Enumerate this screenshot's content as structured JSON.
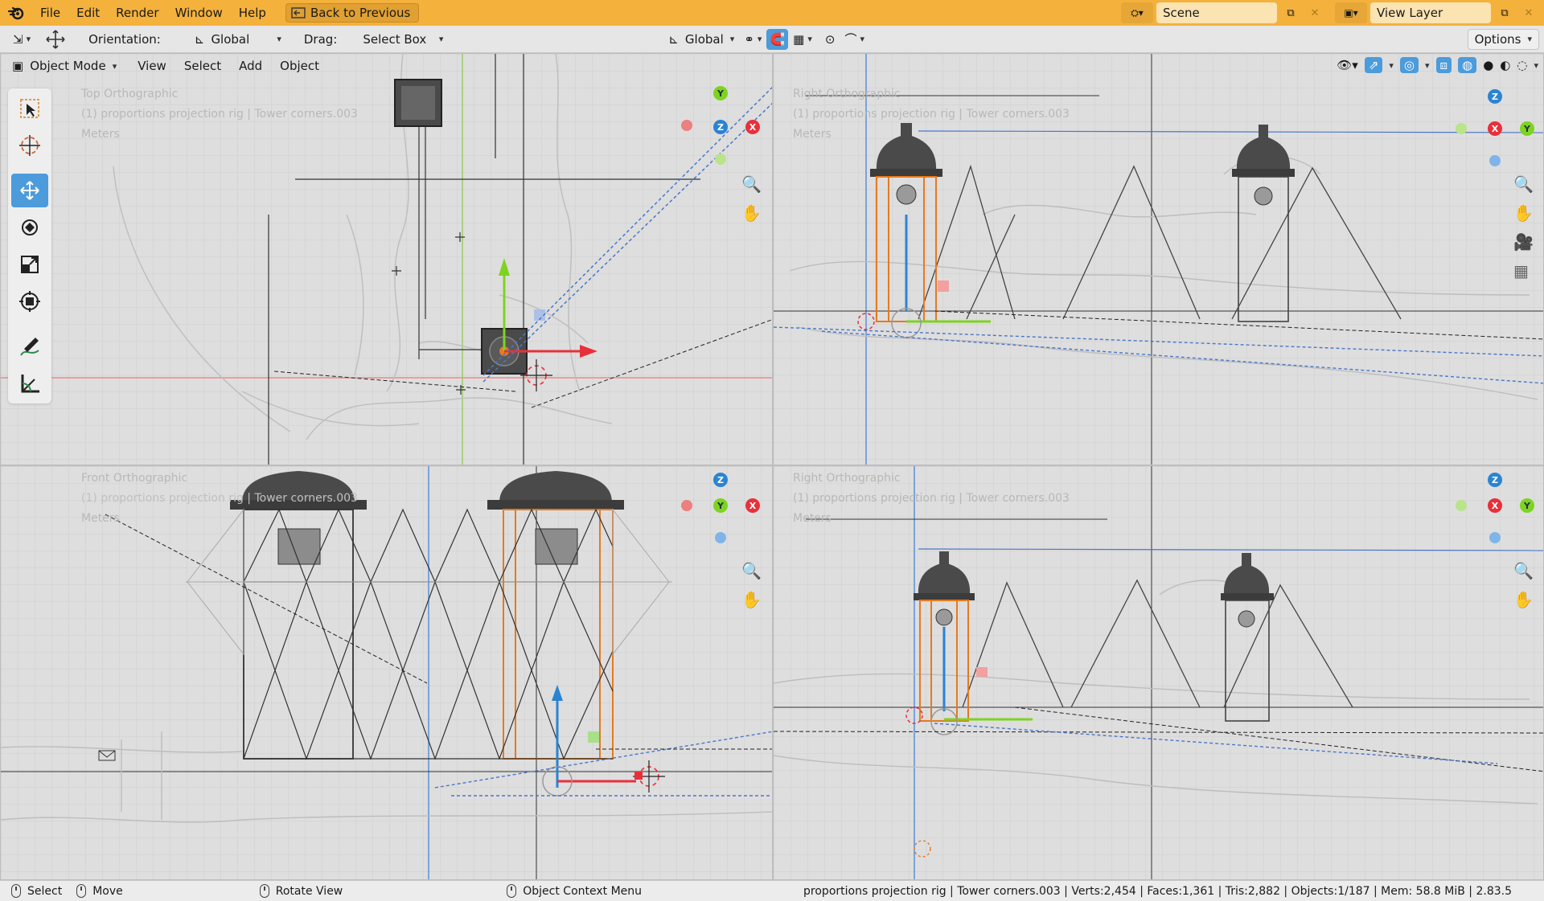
{
  "topbar": {
    "menu": [
      "File",
      "Edit",
      "Render",
      "Window",
      "Help"
    ],
    "back_button": "Back to Previous",
    "scene": "Scene",
    "view_layer": "View Layer"
  },
  "toolbar": {
    "orientation_label": "Orientation:",
    "orientation_value": "Global",
    "drag_label": "Drag:",
    "drag_value": "Select Box",
    "transform_orientation": "Global",
    "options_label": "Options"
  },
  "viewport_header": {
    "mode": "Object Mode",
    "menus": [
      "View",
      "Select",
      "Add",
      "Object"
    ]
  },
  "viewports": {
    "top_left": {
      "name": "Top Orthographic",
      "info": "(1) proportions projection rig | Tower corners.003",
      "units": "Meters"
    },
    "top_right": {
      "name": "Right Orthographic",
      "info": "(1) proportions projection rig | Tower corners.003",
      "units": "Meters"
    },
    "bottom_left": {
      "name": "Front Orthographic",
      "info": "(1) proportions projection rig | Tower corners.003",
      "units": "Meters"
    },
    "bottom_right": {
      "name": "Right Orthographic",
      "info": "(1) proportions projection rig | Tower corners.003",
      "units": "Meters"
    }
  },
  "gizmo_axes": {
    "x": "X",
    "y": "Y",
    "z": "Z"
  },
  "colors": {
    "accent": "#4c9bdb",
    "topbar": "#f4b13c",
    "x_axis": "#e8303a",
    "y_axis": "#7ed321",
    "z_axis": "#2a84d2",
    "selection": "#e57a1f"
  },
  "tools": [
    "select-box-icon",
    "cursor-icon",
    "move-icon",
    "rotate-icon",
    "scale-icon",
    "transform-icon",
    "annotate-icon",
    "measure-icon"
  ],
  "statusbar": {
    "select": "Select",
    "move": "Move",
    "rotate": "Rotate View",
    "context": "Object Context Menu",
    "stats": "proportions projection rig | Tower corners.003 | Verts:2,454 | Faces:1,361 | Tris:2,882 | Objects:1/187 | Mem: 58.8 MiB | 2.83.5"
  }
}
